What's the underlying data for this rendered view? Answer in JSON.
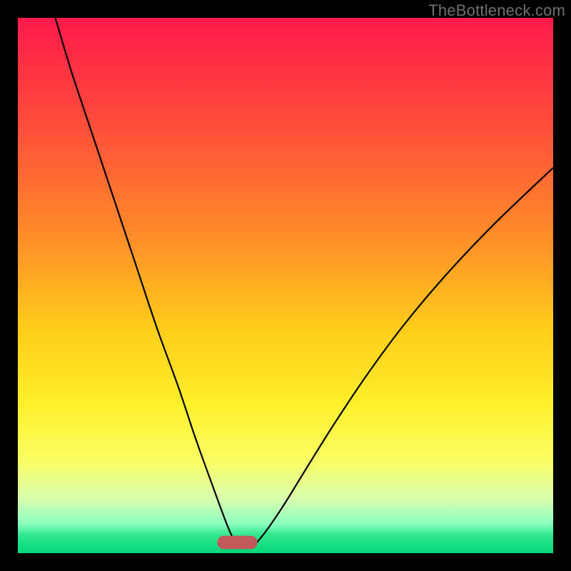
{
  "watermark": "TheBottleneck.com",
  "chart_data": {
    "type": "line",
    "title": "",
    "xlabel": "",
    "ylabel": "",
    "xlim": [
      0,
      100
    ],
    "ylim": [
      0,
      100
    ],
    "grid": false,
    "background_gradient": {
      "stops": [
        {
          "offset": 0.0,
          "color": "#ff1a4b"
        },
        {
          "offset": 0.2,
          "color": "#ff4d3a"
        },
        {
          "offset": 0.4,
          "color": "#ff8a2a"
        },
        {
          "offset": 0.58,
          "color": "#ffcc1a"
        },
        {
          "offset": 0.72,
          "color": "#fff02a"
        },
        {
          "offset": 0.83,
          "color": "#faff66"
        },
        {
          "offset": 0.9,
          "color": "#d8ffb0"
        },
        {
          "offset": 0.945,
          "color": "#8cffc0"
        },
        {
          "offset": 0.965,
          "color": "#33e890"
        },
        {
          "offset": 1.0,
          "color": "#00d878"
        }
      ]
    },
    "marker": {
      "x": 41,
      "y": 2,
      "width": 7.5,
      "height": 2.5,
      "color": "#c05a5a",
      "rx": 1.2
    },
    "series": [
      {
        "name": "left-branch",
        "x": [
          7,
          10,
          14,
          18,
          22,
          26,
          30,
          33,
          35.5,
          37.5,
          39.2,
          40.5,
          41.4
        ],
        "y": [
          100,
          90,
          78,
          66,
          54,
          42,
          31,
          22,
          15,
          9.5,
          5,
          2.2,
          1.2
        ]
      },
      {
        "name": "right-branch",
        "x": [
          43.8,
          45.0,
          47.0,
          50.0,
          54.0,
          59.0,
          65.0,
          72.0,
          80.0,
          89.0,
          100.0
        ],
        "y": [
          1.2,
          2.4,
          5.0,
          9.5,
          16.0,
          24.0,
          33.0,
          42.5,
          52.0,
          61.5,
          72.0
        ]
      }
    ],
    "line_style": {
      "color": "#000000",
      "width": 2.2
    }
  }
}
